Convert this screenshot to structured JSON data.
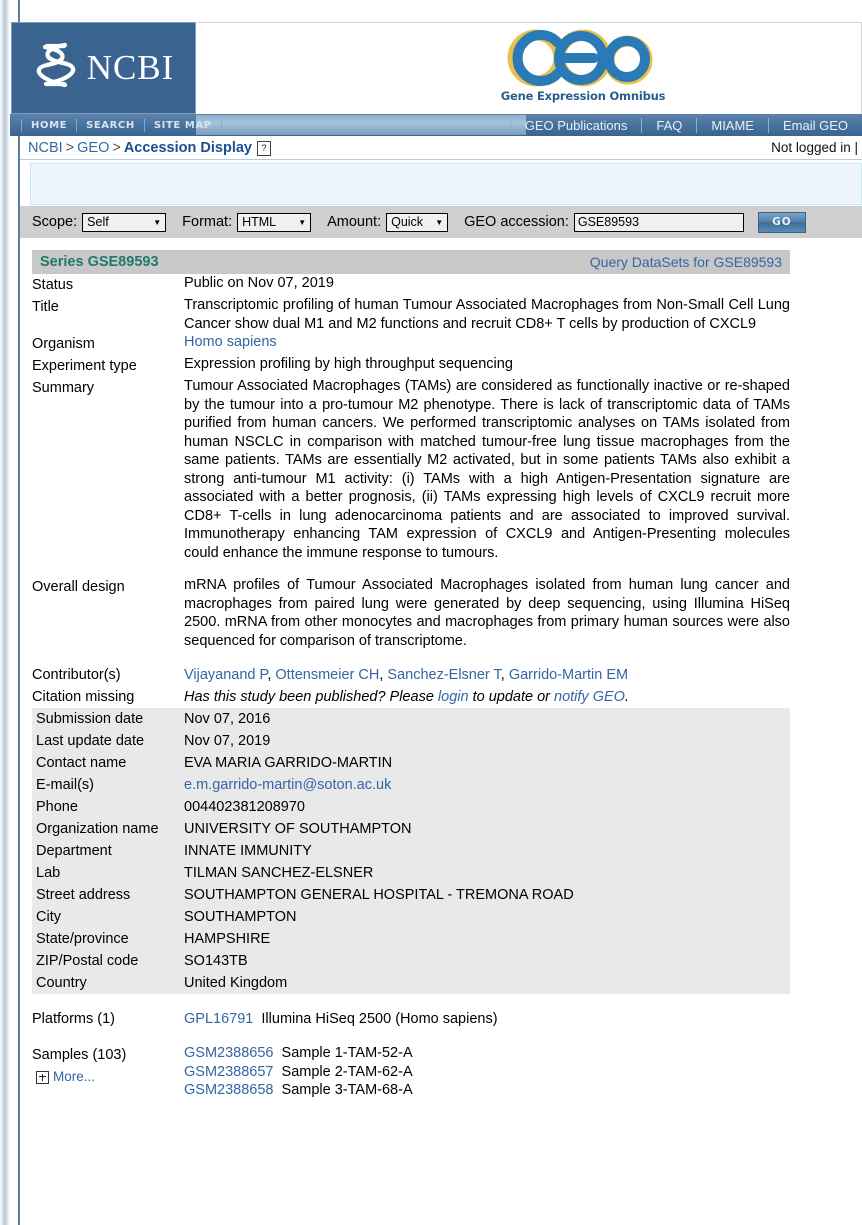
{
  "brand": {
    "ncbi_word": "NCBI",
    "geo_caption": "Gene Expression Omnibus"
  },
  "topnav": {
    "left_items": [
      "HOME",
      "SEARCH",
      "SITE MAP"
    ],
    "right_items": [
      "GEO Publications",
      "FAQ",
      "MIAME",
      "Email GEO"
    ]
  },
  "breadcrumb": {
    "root": "NCBI",
    "sep": ">",
    "section": "GEO",
    "current": "Accession Display",
    "help_glyph": "?",
    "login_status": "Not logged in |"
  },
  "toolbar": {
    "scope_label": "Scope:",
    "scope_value": "Self",
    "format_label": "Format:",
    "format_value": "HTML",
    "amount_label": "Amount:",
    "amount_value": "Quick",
    "accession_label": "GEO accession:",
    "accession_value": "GSE89593",
    "go_label": "GO",
    "arrow_glyph": "▼"
  },
  "record": {
    "series_title": "Series GSE89593",
    "query_link": "Query DataSets for GSE89593",
    "status_key": "Status",
    "status_value": "Public on Nov 07, 2019",
    "title_key": "Title",
    "title_value": "Transcriptomic profiling of human Tumour Associated Macrophages from Non-Small Cell Lung Cancer show dual M1 and M2 functions and recruit CD8+ T cells by production of CXCL9",
    "organism_key": "Organism",
    "organism_value": "Homo sapiens",
    "exptype_key": "Experiment type",
    "exptype_value": "Expression profiling by high throughput sequencing",
    "summary_key": "Summary",
    "summary_value": "Tumour Associated Macrophages (TAMs) are considered as functionally inactive or re-shaped by the tumour into a pro-tumour M2 phenotype. There is lack of transcriptomic data of TAMs purified from human cancers. We performed transcriptomic analyses on TAMs isolated from human NSCLC in comparison with matched tumour-free lung tissue macrophages from the same patients. TAMs are essentially M2 activated, but in some patients TAMs also exhibit a strong anti-tumour M1 activity: (i) TAMs with a high Antigen-Presentation signature are associated with a better prognosis, (ii) TAMs expressing high levels of CXCL9 recruit more CD8+ T-cells in lung adenocarcinoma patients and are associated to improved survival. Immunotherapy enhancing TAM expression of CXCL9 and Antigen-Presenting molecules could enhance the immune response to tumours.",
    "design_key": "Overall design",
    "design_value": "mRNA profiles of Tumour Associated Macrophages isolated from human lung cancer and macrophages from paired lung were generated by deep sequencing, using Illumina HiSeq 2500. mRNA from other monocytes and macrophages from primary human sources were also sequenced for comparison of transcriptome.",
    "contributors_key": "Contributor(s)",
    "contributors": [
      "Vijayanand P",
      "Ottensmeier CH",
      "Sanchez-Elsner T",
      "Garrido-Martin EM"
    ],
    "citation_key": "Citation missing",
    "citation_pre": "Has this study been published? Please ",
    "citation_login": "login",
    "citation_mid": " to update or ",
    "citation_notify": "notify GEO",
    "citation_post": ".",
    "submission_key": "Submission date",
    "submission_value": "Nov 07, 2016",
    "lastupdate_key": "Last update date",
    "lastupdate_value": "Nov 07, 2019",
    "contactname_key": "Contact name",
    "contactname_value": "EVA MARIA GARRIDO-MARTIN",
    "email_key": "E-mail(s)",
    "email_value": "e.m.garrido-martin@soton.ac.uk",
    "phone_key": "Phone",
    "phone_value": "004402381208970",
    "org_key": "Organization name",
    "org_value": "UNIVERSITY OF SOUTHAMPTON",
    "dept_key": "Department",
    "dept_value": "INNATE IMMUNITY",
    "lab_key": "Lab",
    "lab_value": "TILMAN SANCHEZ-ELSNER",
    "street_key": "Street address",
    "street_value": "SOUTHAMPTON GENERAL HOSPITAL - TREMONA ROAD",
    "city_key": "City",
    "city_value": "SOUTHAMPTON",
    "state_key": "State/province",
    "state_value": "HAMPSHIRE",
    "zip_key": "ZIP/Postal code",
    "zip_value": "SO143TB",
    "country_key": "Country",
    "country_value": "United Kingdom",
    "platforms_key": "Platforms (1)",
    "platform_id": "GPL16791",
    "platform_name": "Illumina HiSeq 2500 (Homo sapiens)",
    "samples_key": "Samples (103)",
    "more_label": "More...",
    "samples": [
      {
        "id": "GSM2388656",
        "name": "Sample 1-TAM-52-A"
      },
      {
        "id": "GSM2388657",
        "name": "Sample 2-TAM-62-A"
      },
      {
        "id": "GSM2388658",
        "name": "Sample 3-TAM-68-A"
      }
    ]
  },
  "colors": {
    "ncbi_blue": "#3b6390",
    "link_blue": "#3465a4",
    "series_teal": "#1f7a6a",
    "toolbar_gray": "#cfcfcf",
    "shade_gray": "#e9e9e9"
  }
}
